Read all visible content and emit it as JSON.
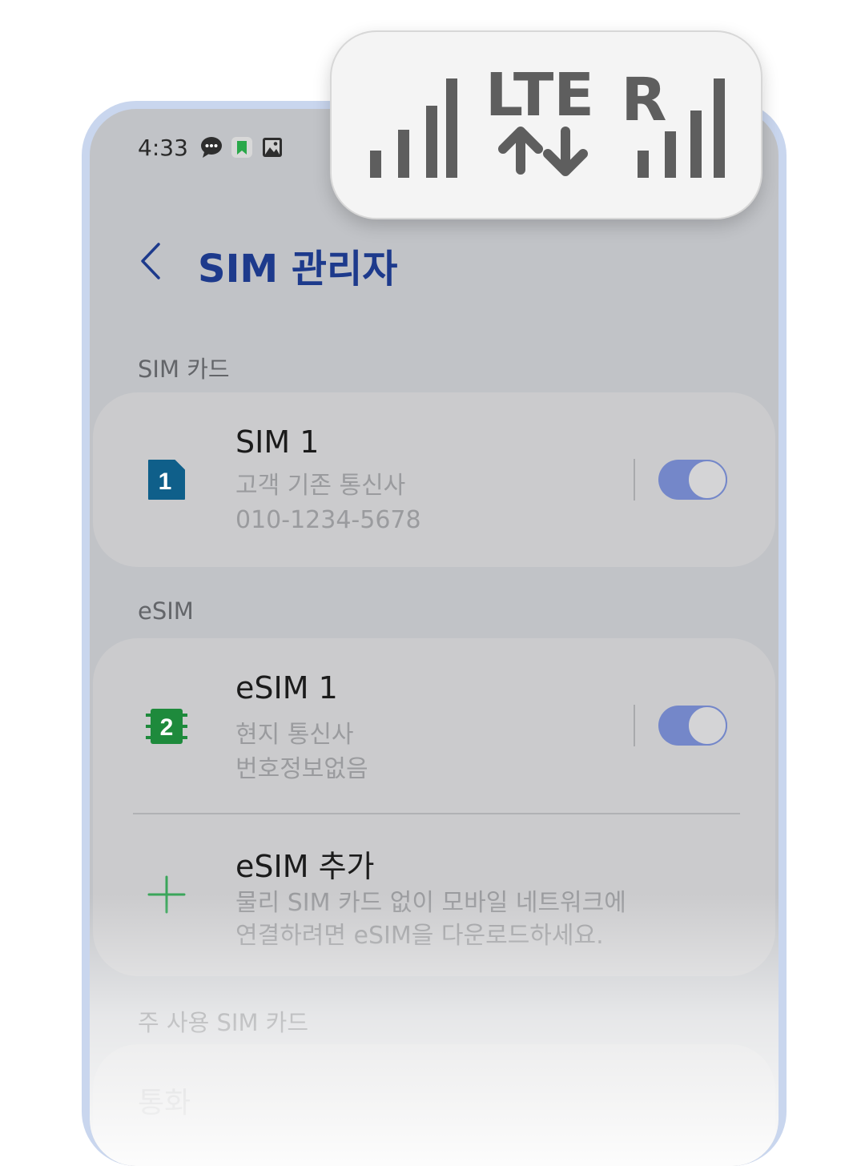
{
  "status_bar": {
    "time": "4:33",
    "icons": [
      "chat-bubble-icon",
      "bookmark-icon",
      "image-icon"
    ],
    "bookmark_color": "#2aa84a"
  },
  "network_callout": {
    "network_type": "LTE",
    "roaming": "R",
    "icons": [
      "signal-bars-icon",
      "data-up-down-arrows-icon",
      "roaming-signal-bars-icon"
    ],
    "icon_color": "#5e5e5e"
  },
  "header": {
    "title": "SIM 관리자",
    "back_icon": "chevron-left-icon",
    "title_color": "#1d3a8c"
  },
  "sim_section": {
    "label": "SIM 카드",
    "item": {
      "title": "SIM 1",
      "carrier": "고객 기존 통신사",
      "number": "010-1234-5678",
      "badge": "1",
      "badge_color": "#0f5f8a",
      "enabled": true
    }
  },
  "esim_section": {
    "label": "eSIM",
    "item": {
      "title": "eSIM 1",
      "carrier": "현지 통신사",
      "number": "번호정보없음",
      "badge": "2",
      "badge_color": "#1e8a3c",
      "enabled": true
    },
    "add": {
      "title": "eSIM 추가",
      "line1": "물리 SIM 카드 없이 모바일 네트워크에",
      "line2": "연결하려면 eSIM을 다운로드하세요.",
      "plus_color": "#3aa55a"
    }
  },
  "primary_section": {
    "label": "주 사용 SIM 카드",
    "first_item": "통화"
  },
  "toggle_color": "#7487c9"
}
